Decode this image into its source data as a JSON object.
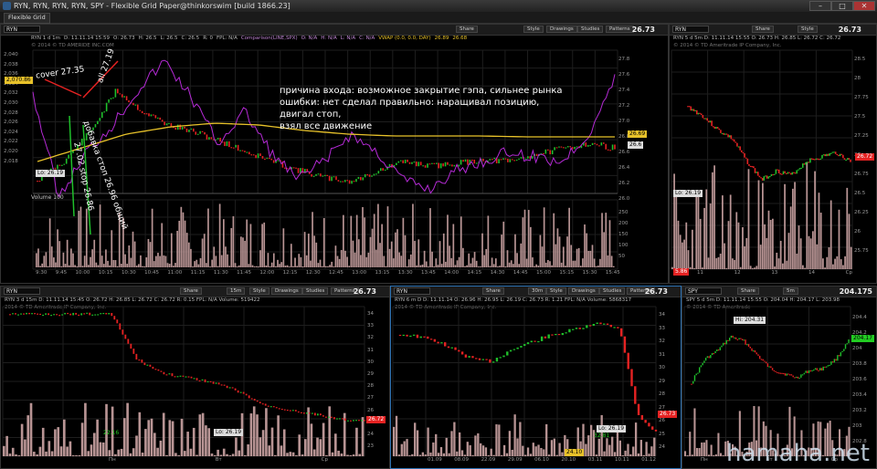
{
  "window": {
    "title": "RYN, RYN, RYN, RYN, SPY - Flexible Grid Paper@thinkorswim [build 1866.23]",
    "tab": "Flexible Grid",
    "minimize": "–",
    "maximize": "□",
    "close": "✕"
  },
  "toolbar": {
    "share": "Share",
    "style": "Style",
    "drawings": "Drawings",
    "studies": "Studies",
    "patterns": "Patterns"
  },
  "main": {
    "symbol": "RYN",
    "price": "26.73",
    "info": [
      "RYN 1 d 1m",
      "D: 11.11.14 15:59",
      "O: 26.73",
      "H: 26.5",
      "L: 26.5",
      "C: 26.5",
      "R: 0",
      "FPL: N/A",
      "Comparison(LINE,SPX)",
      "O: N/A",
      "H: N/A",
      "L: N/A",
      "C: N/A",
      "VWAP (0.0, 0.0, DAY)",
      "26.89",
      "26.68"
    ],
    "company": "© 2014 © TD AMERIDE INC.COM",
    "volume_label": "Volume",
    "volume_value": "100",
    "lo_label": "Lo: 26.19",
    "price_tag": "26.73",
    "vwap_tag": "26.69",
    "ref_tag": "26.6",
    "left_tag": "2,070.86",
    "left_axis": [
      "2,040",
      "2,038",
      "2,036",
      "2,034",
      "2,032",
      "2,030",
      "2,028",
      "2,026",
      "2,024",
      "2,022",
      "2,020",
      "2,018"
    ],
    "right_axis": [
      "27.8",
      "27.6",
      "27.4",
      "27.2",
      "27.0",
      "26.8",
      "26.6",
      "26.4",
      "26.2",
      "26.0"
    ],
    "vol_axis": [
      "250",
      "200",
      "150",
      "100",
      "50"
    ],
    "time_axis": [
      "9:30",
      "9:45",
      "10:00",
      "10:15",
      "10:30",
      "10:45",
      "11:00",
      "11:15",
      "11:30",
      "11:45",
      "12:00",
      "12:15",
      "12:30",
      "12:45",
      "13:00",
      "13:15",
      "13:30",
      "13:45",
      "14:00",
      "14:15",
      "14:30",
      "14:45",
      "15:00",
      "15:15",
      "15:30",
      "15:45"
    ]
  },
  "annotations": {
    "cover": "cover 27.35",
    "all": "all 27.19",
    "add_stop": "добавка стоп 26.96 общий",
    "stop": "27.02 stop 26.86",
    "reason_lines": [
      "причина входа: возможное закрытие гэпа, сильнее рынка",
      "ошибки: нет сделал правильно: наращивал позицию, двигал стоп,",
      "взял все движение"
    ]
  },
  "top_right": {
    "symbol": "RYN",
    "price": "26.73",
    "info": "RYN 5 d 5m  D: 11.11.14 15:55  O: 26.73  H: 26.85  L: 26.72  C: 26.72",
    "company": "© 2014 © TD Ameritrade IP Company, Inc.",
    "lo_label": "Lo: 26.19",
    "price_tag": "26.72",
    "low_tag": "5.86",
    "right_axis": [
      "28.5",
      "28",
      "27.75",
      "27.5",
      "27.25",
      "27",
      "26.75",
      "26.5",
      "26.25",
      "26",
      "25.75"
    ],
    "x_axis": [
      "11",
      "12",
      "13",
      "14",
      "Ср"
    ]
  },
  "bottom_left": {
    "symbol": "RYN",
    "price": "26.73",
    "period": "15m",
    "info": "RYN 3 d 15m  D: 11.11.14 15:45  O: 26.72  H: 26.85  L: 26.72  C: 26.72  R: 0.15  FPL: N/A  Volume: 519422",
    "company": "2014 © TD Ameritrade IP Company, Inc.",
    "lo_label": "Lo: 26.19",
    "price_tag": "26.72",
    "low_tag": "22.16",
    "right_axis": [
      "34",
      "33",
      "32",
      "31",
      "30",
      "29",
      "28",
      "27",
      "26",
      "25",
      "24",
      "23"
    ],
    "x_axis": [
      "Пн",
      "Вт",
      "Ср"
    ]
  },
  "bottom_mid": {
    "symbol": "RYN",
    "price": "26.73",
    "period": "30m",
    "info": "RYN 6 m D  D: 11.11.14  O: 26.96  H: 26.95  L: 26.19  C: 26.73  R: 1.21  FPL: N/A  Volume: 5868317",
    "company": "2014 © TD Ameritrade IP Company, Inc.",
    "lo_label": "Lo: 26.19",
    "price_tag": "26.73",
    "low_tag": "24.10",
    "low_tag2": "32.81",
    "right_axis": [
      "34",
      "33",
      "32",
      "31",
      "30",
      "29",
      "28",
      "27",
      "26",
      "25",
      "24"
    ],
    "x_axis": [
      "01.09",
      "08.09",
      "22.09",
      "29.09",
      "06.10",
      "20.10",
      "03.11",
      "10.11",
      "01.12"
    ]
  },
  "bottom_right": {
    "symbol": "SPY",
    "price": "204.175",
    "period": "5m",
    "info": "SPY 5 d 5m  D: 11.11.14 15:55  O: 204.04  H: 204.17  L: 203.98",
    "company": "© 2014 © TD Ameritrade",
    "hi_label": "Hi: 204.31",
    "price_tag": "204.17",
    "right_axis": [
      "204.4",
      "204.2",
      "204",
      "203.8",
      "203.6",
      "203.4",
      "203.2",
      "203",
      "202.8"
    ],
    "x_axis": [
      "Пн",
      "Вт",
      "Ср"
    ]
  },
  "watermark": "hamaha.net",
  "colors": {
    "up": "#1fbf2b",
    "down": "#e52222",
    "vwap": "#e8c22a",
    "comparison": "#b52ad6",
    "volume": "#b89494"
  }
}
